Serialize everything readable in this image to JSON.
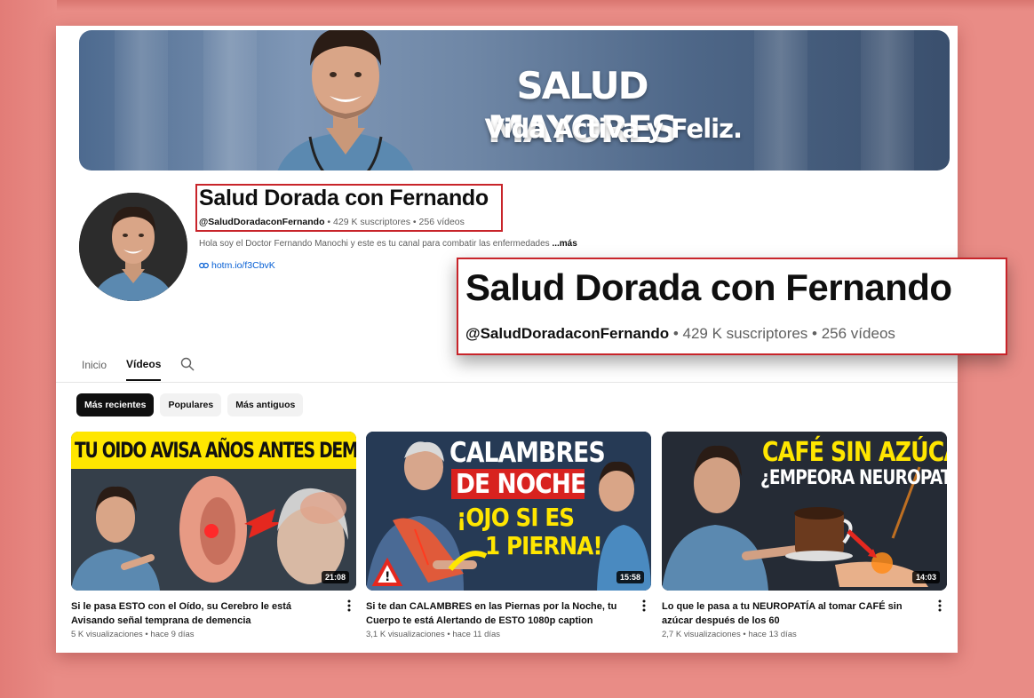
{
  "banner": {
    "title": "SALUD MAYORES",
    "subtitle": "Vida Activa y Feliz."
  },
  "channel": {
    "name": "Salud Dorada con Fernando",
    "handle": "@SaludDoradaconFernando",
    "subscribers": "429 K suscriptores",
    "videos_count": "256 vídeos",
    "separator": " • ",
    "description": "Hola soy el Doctor Fernando Manochi y este es tu canal para combatir las enfermedades",
    "more_label": "...más",
    "link": "hotm.io/f3CbvK"
  },
  "zoom": {
    "name": "Salud Dorada con Fernando",
    "handle": "@SaludDoradaconFernando",
    "subscribers": "429 K suscriptores",
    "videos_count": "256 vídeos",
    "separator": " • "
  },
  "tabs": [
    {
      "label": "Inicio",
      "active": false
    },
    {
      "label": "Vídeos",
      "active": true
    }
  ],
  "chips": [
    {
      "label": "Más recientes",
      "active": true
    },
    {
      "label": "Populares",
      "active": false
    },
    {
      "label": "Más antiguos",
      "active": false
    }
  ],
  "videos": [
    {
      "thumb_lines": [
        "TU OIDO AVISA AÑOS ANTES DEMENCIA"
      ],
      "duration": "21:08",
      "title": "Si le pasa ESTO con el Oído, su Cerebro le está Avisando señal temprana de demencia",
      "views": "5 K visualizaciones",
      "age": "hace 9 días"
    },
    {
      "thumb_lines": [
        "CALAMBRES",
        "DE NOCHE",
        "¡OJO SI ES",
        "1 PIERNA!"
      ],
      "duration": "15:58",
      "title": "Si te dan CALAMBRES en las Piernas por la Noche, tu Cuerpo te está Alertando de ESTO 1080p caption",
      "views": "3,1 K visualizaciones",
      "age": "hace 11 días"
    },
    {
      "thumb_lines": [
        "CAFÉ SIN AZÚCAR",
        "¿EMPEORA NEUROPATÍA?"
      ],
      "duration": "14:03",
      "title": "Lo que le pasa a tu NEUROPATÍA al tomar CAFÉ sin azúcar después de los 60",
      "views": "2,7 K visualizaciones",
      "age": "hace 13 días"
    }
  ],
  "colors": {
    "background": "#e98c86",
    "highlight_border": "#c8242a",
    "link": "#065fd4",
    "thumb_yellow": "#ffe600"
  }
}
